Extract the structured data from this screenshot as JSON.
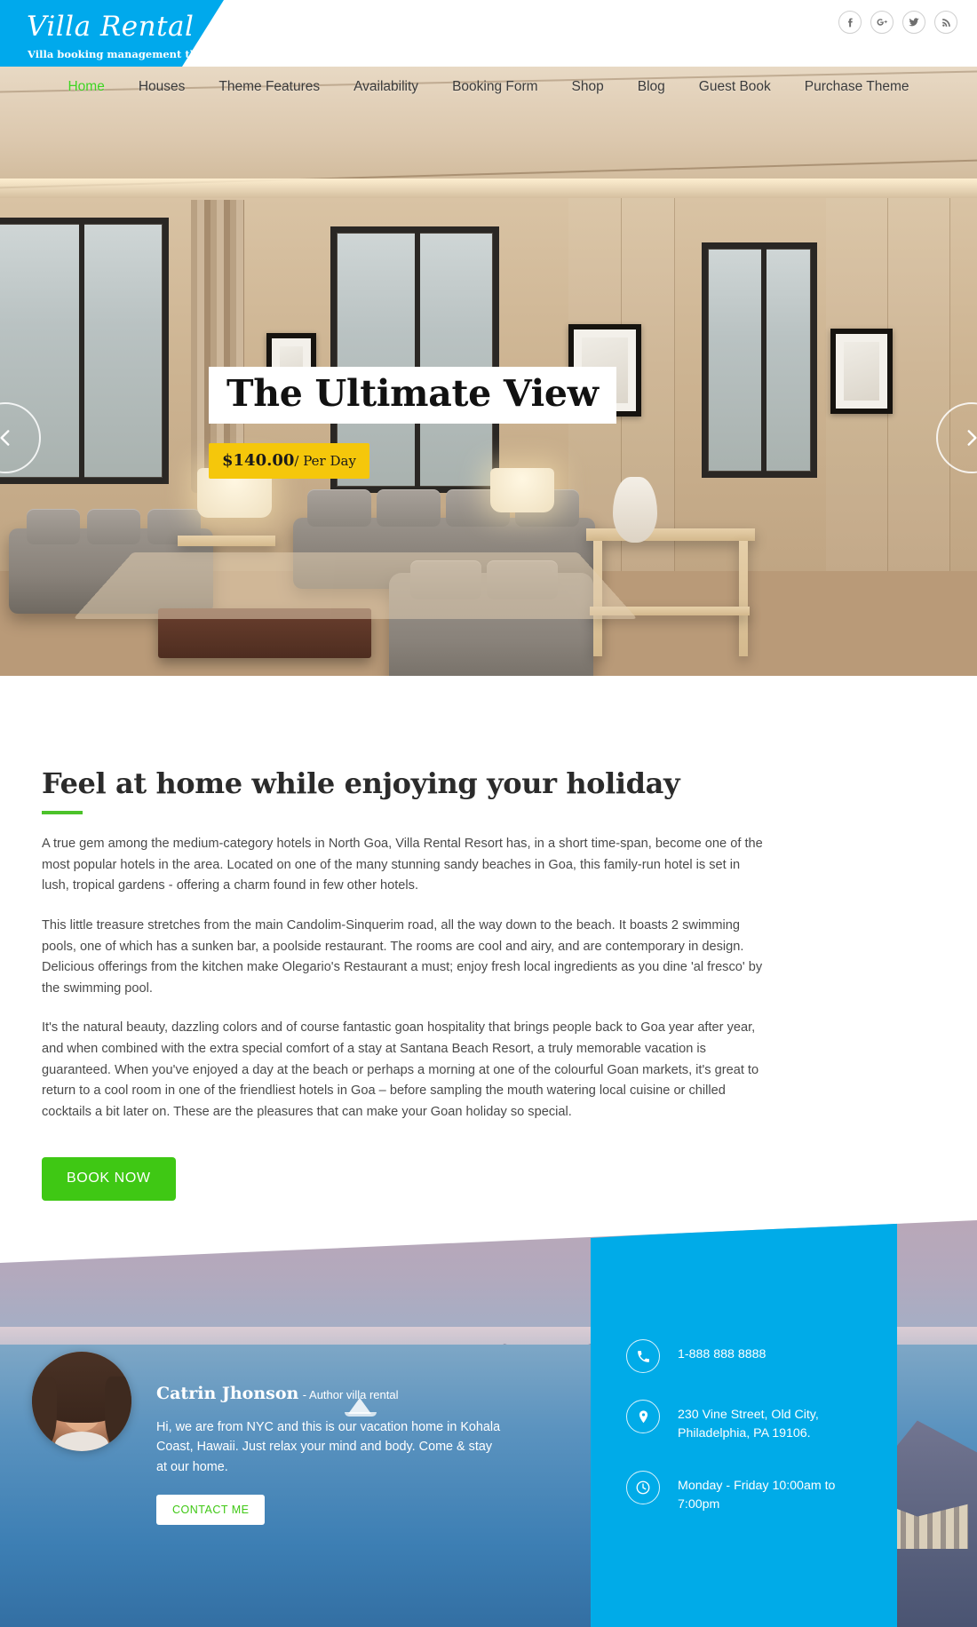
{
  "brand": {
    "name": "Villa Rental",
    "tagline": "Villa booking management theme",
    "accent_blue": "#00a9ec",
    "accent_green": "#3fc814",
    "accent_yellow": "#f5c70b"
  },
  "social": [
    {
      "name": "facebook-icon",
      "glyph": "f"
    },
    {
      "name": "google-plus-icon",
      "glyph": "g+"
    },
    {
      "name": "twitter-icon",
      "glyph": "t"
    },
    {
      "name": "rss-icon",
      "glyph": "rss"
    }
  ],
  "nav": {
    "items": [
      {
        "label": "Home",
        "active": true
      },
      {
        "label": "Houses",
        "active": false
      },
      {
        "label": "Theme Features",
        "active": false
      },
      {
        "label": "Availability",
        "active": false
      },
      {
        "label": "Booking Form",
        "active": false
      },
      {
        "label": "Shop",
        "active": false
      },
      {
        "label": "Blog",
        "active": false
      },
      {
        "label": "Guest Book",
        "active": false
      },
      {
        "label": "Purchase Theme",
        "active": false
      }
    ]
  },
  "hero": {
    "slide_title": "The Ultimate View",
    "price_amount": "$140.00",
    "price_unit": "/ Per Day",
    "prev_label": "Previous slide",
    "next_label": "Next slide"
  },
  "about": {
    "heading": "Feel at home while enjoying your holiday",
    "paragraph1": "A true gem among the medium-category hotels in North Goa, Villa Rental Resort has, in a short time-span, become one of the most popular hotels in the area. Located on one of the many stunning sandy beaches in Goa, this family-run hotel is set in lush, tropical gardens - offering a charm found in few other hotels.",
    "paragraph2": "This little treasure stretches from the main Candolim-Sinquerim road, all the way down to the beach. It boasts 2 swimming pools, one of which has a sunken bar, a poolside restaurant. The rooms are cool and airy, and are contemporary in design. Delicious offerings from the kitchen make Olegario's Restaurant a must; enjoy fresh local ingredients as you dine 'al fresco' by the swimming pool.",
    "paragraph3": "It's the natural beauty, dazzling colors and of course fantastic goan hospitality that brings people back to Goa year after year, and when combined with the extra special comfort of a stay at Santana Beach Resort, a truly memorable vacation is guaranteed. When you've enjoyed a day at the beach or perhaps a morning at one of the colourful Goan markets, it's great to return to a cool room in one of the friendliest hotels in Goa – before sampling the mouth watering local cuisine or chilled cocktails a bit later on. These are the pleasures that can make your Goan holiday so special.",
    "book_button": "BOOK NOW"
  },
  "testimonial": {
    "author_name": "Catrin Jhonson",
    "author_role": "- Author villa rental",
    "quote": "Hi, we are from NYC and this is our vacation home in Kohala Coast, Hawaii. Just relax your mind and body. Come & stay at our home.",
    "contact_button": "CONTACT ME"
  },
  "contact": {
    "items": [
      {
        "icon": "phone-icon",
        "text": "1-888 888 8888"
      },
      {
        "icon": "location-pin-icon",
        "text": "230 Vine Street, Old City, Philadelphia, PA 19106."
      },
      {
        "icon": "clock-icon",
        "text": "Monday - Friday 10:00am to 7:00pm"
      }
    ]
  }
}
